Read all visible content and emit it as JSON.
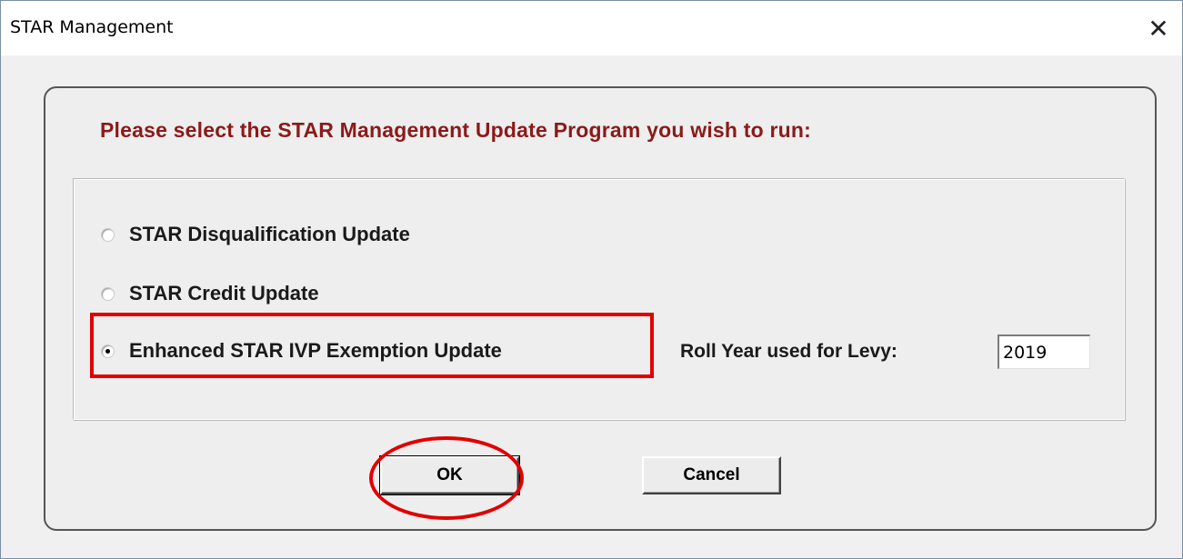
{
  "window": {
    "title": "STAR Management",
    "close_glyph": "✕"
  },
  "prompt": "Please select the STAR Management Update Program you wish to run:",
  "options": [
    {
      "label": "STAR Disqualification Update",
      "selected": false
    },
    {
      "label": "STAR Credit Update",
      "selected": false
    },
    {
      "label": "Enhanced STAR IVP Exemption Update",
      "selected": true
    }
  ],
  "roll_year": {
    "label": "Roll Year used for Levy:",
    "value": "2019"
  },
  "buttons": {
    "ok": "OK",
    "cancel": "Cancel"
  },
  "colors": {
    "prompt_text": "#8b1a1a",
    "annotation_red": "#e10000",
    "dialog_bg": "#f0f0f0"
  },
  "icons": {
    "close": "close-icon"
  }
}
